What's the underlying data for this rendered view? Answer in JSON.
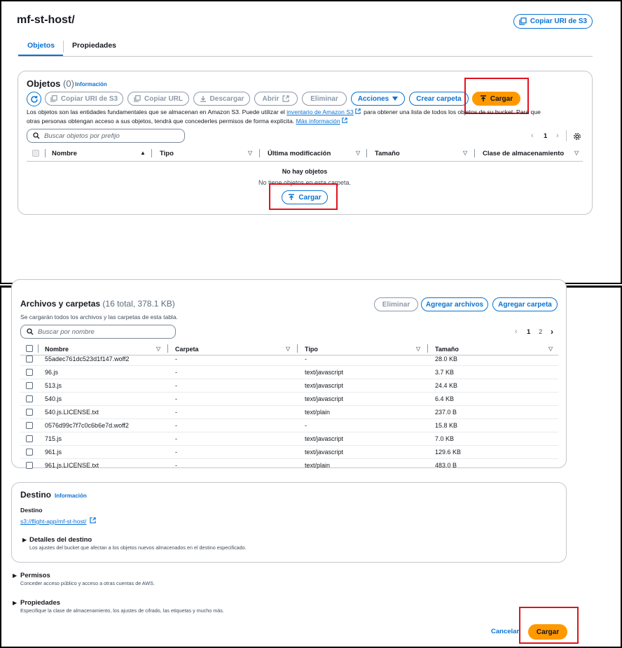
{
  "top": {
    "title": "mf-st-host/",
    "copy_uri_button": "Copiar URI de S3",
    "tabs": [
      "Objetos",
      "Propiedades"
    ],
    "objects_panel": {
      "heading": "Objetos",
      "count": "(0)",
      "info_link": "Información",
      "toolbar": {
        "copy_uri": "Copiar URI de S3",
        "copy_url": "Copiar URL",
        "download": "Descargar",
        "open": "Abrir",
        "delete": "Eliminar",
        "actions": "Acciones",
        "create_folder": "Crear carpeta",
        "upload": "Cargar"
      },
      "description_1": "Los objetos son las entidades fundamentales que se almacenan en Amazon S3. Puede utilizar el ",
      "description_link": "inventario de Amazon S3",
      "description_2": " para obtener una lista de todos los objetos de su bucket. Para que",
      "description_3": "otras personas obtengan acceso a sus objetos, tendrá que concederles permisos de forma explícita. ",
      "more_info_link": "Más información",
      "search_placeholder": "Buscar objetos por prefijo",
      "page_number": "1",
      "columns": [
        "Nombre",
        "Tipo",
        "Última modificación",
        "Tamaño",
        "Clase de almacenamiento"
      ],
      "empty_title": "No hay objetos",
      "empty_text": "No tiene objetos en esta carpeta.",
      "empty_upload": "Cargar"
    }
  },
  "bottom": {
    "files_panel": {
      "heading": "Archivos y carpetas",
      "count": "(16 total, 378.1 KB)",
      "subtitle": "Se cargarán todos los archivos y las carpetas de esta tabla.",
      "delete": "Eliminar",
      "add_files": "Agregar archivos",
      "add_folder": "Agregar carpeta",
      "search_placeholder": "Buscar por nombre",
      "pages": [
        "1",
        "2"
      ],
      "columns": [
        "Nombre",
        "Carpeta",
        "Tipo",
        "Tamaño"
      ],
      "rows": [
        {
          "name": "55adec761dc523d1f147.woff2",
          "folder": "-",
          "type": "-",
          "size": "28.0 KB"
        },
        {
          "name": "96.js",
          "folder": "-",
          "type": "text/javascript",
          "size": "3.7 KB"
        },
        {
          "name": "513.js",
          "folder": "-",
          "type": "text/javascript",
          "size": "24.4 KB"
        },
        {
          "name": "540.js",
          "folder": "-",
          "type": "text/javascript",
          "size": "6.4 KB"
        },
        {
          "name": "540.js.LICENSE.txt",
          "folder": "-",
          "type": "text/plain",
          "size": "237.0 B"
        },
        {
          "name": "0576d99c7f7c0c6b6e7d.woff2",
          "folder": "-",
          "type": "-",
          "size": "15.8 KB"
        },
        {
          "name": "715.js",
          "folder": "-",
          "type": "text/javascript",
          "size": "7.0 KB"
        },
        {
          "name": "961.js",
          "folder": "-",
          "type": "text/javascript",
          "size": "129.6 KB"
        },
        {
          "name": "961.js.LICENSE.txt",
          "folder": "-",
          "type": "text/plain",
          "size": "483.0 B"
        }
      ]
    },
    "destination": {
      "heading": "Destino",
      "info_link": "Información",
      "label": "Destino",
      "url": "s3://flight-app/mf-st-host/",
      "details_title": "Detalles del destino",
      "details_text": "Los ajustes del bucket que afectan a los objetos nuevos almacenados en el destino especificado."
    },
    "permissions": {
      "title": "Permisos",
      "text": "Conceder acceso público y acceso a otras cuentas de AWS."
    },
    "properties": {
      "title": "Propiedades",
      "text": "Especifique la clase de almacenamiento, los ajustes de cifrado, las etiquetas y mucho más."
    },
    "cancel": "Cancelar",
    "upload": "Cargar"
  },
  "colors": {
    "accent": "#0972d3",
    "primary_button": "#ff9900",
    "highlight": "#e0121b"
  }
}
